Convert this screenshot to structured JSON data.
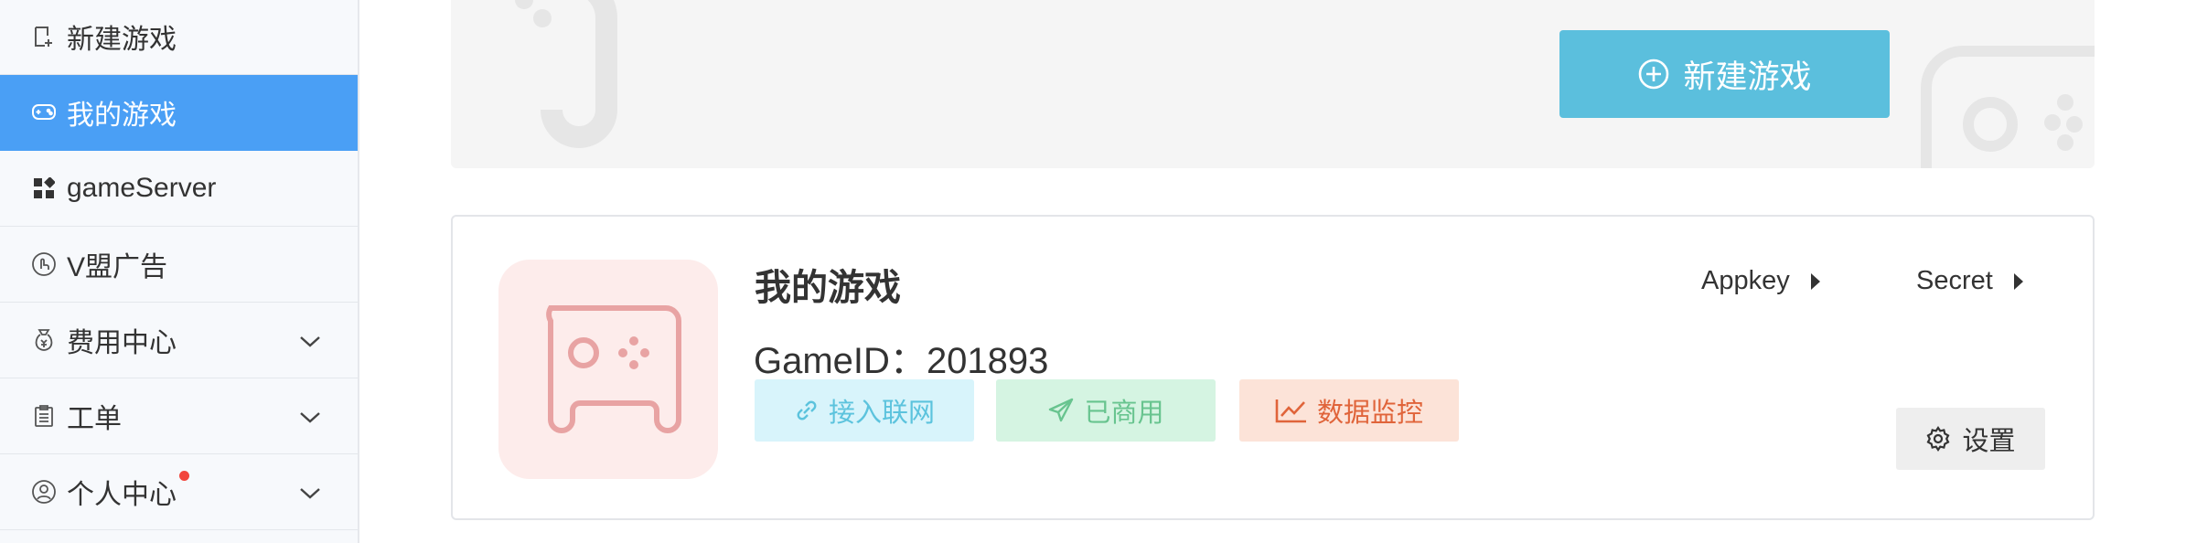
{
  "sidebar": {
    "items": [
      {
        "label": "新建游戏",
        "icon": "new-doc-icon"
      },
      {
        "label": "我的游戏",
        "icon": "gamepad-icon",
        "active": true
      },
      {
        "label": "gameServer",
        "icon": "grid-icon"
      },
      {
        "label": "V盟广告",
        "icon": "hand-icon"
      },
      {
        "label": "费用中心",
        "icon": "money-bag-icon",
        "expandable": true
      },
      {
        "label": "工单",
        "icon": "clipboard-icon",
        "expandable": true
      },
      {
        "label": "个人中心",
        "icon": "user-icon",
        "expandable": true,
        "badge": "red-dot"
      }
    ]
  },
  "banner": {
    "new_game_label": "新建游戏",
    "new_game_icon": "plus-circle-icon"
  },
  "game_card": {
    "name": "我的游戏",
    "game_id_label": "GameID：",
    "game_id": "201893",
    "appkey_label": "Appkey",
    "secret_label": "Secret",
    "buttons": {
      "access": "接入联网",
      "commercial": "已商用",
      "monitor": "数据监控",
      "settings": "设置"
    }
  },
  "colors": {
    "active_nav": "#4a9ff5",
    "primary_button": "#5bbfdd",
    "access_bg": "#d8f4fb",
    "access_text": "#5cc3dd",
    "commercial_bg": "#d5f4e2",
    "commercial_text": "#68c48f",
    "monitor_bg": "#fce3d8",
    "monitor_text": "#e0643a",
    "logo_bg": "#fdeceb",
    "logo_stroke": "#e8a3a3",
    "badge": "#f2453d"
  }
}
